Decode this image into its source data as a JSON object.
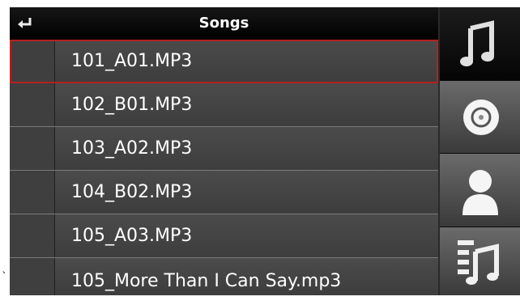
{
  "header": {
    "title": "Songs",
    "back_icon": "return-arrow-icon"
  },
  "songs": [
    {
      "name": "101_A01.MP3",
      "selected": true
    },
    {
      "name": "102_B01.MP3",
      "selected": false
    },
    {
      "name": "103_A02.MP3",
      "selected": false
    },
    {
      "name": "104_B02.MP3",
      "selected": false
    },
    {
      "name": "105_A03.MP3",
      "selected": false
    },
    {
      "name": "105_More Than I Can Say.mp3",
      "selected": false
    }
  ],
  "sidebar": {
    "items": [
      {
        "icon": "music-note-icon",
        "active": true
      },
      {
        "icon": "disc-icon",
        "active": false
      },
      {
        "icon": "artist-icon",
        "active": false
      },
      {
        "icon": "playlist-icon",
        "active": false
      }
    ]
  },
  "stray_mark": "`",
  "colors": {
    "selection_outline": "#b52020",
    "row_background": "#444444",
    "header_background": "#000000"
  }
}
